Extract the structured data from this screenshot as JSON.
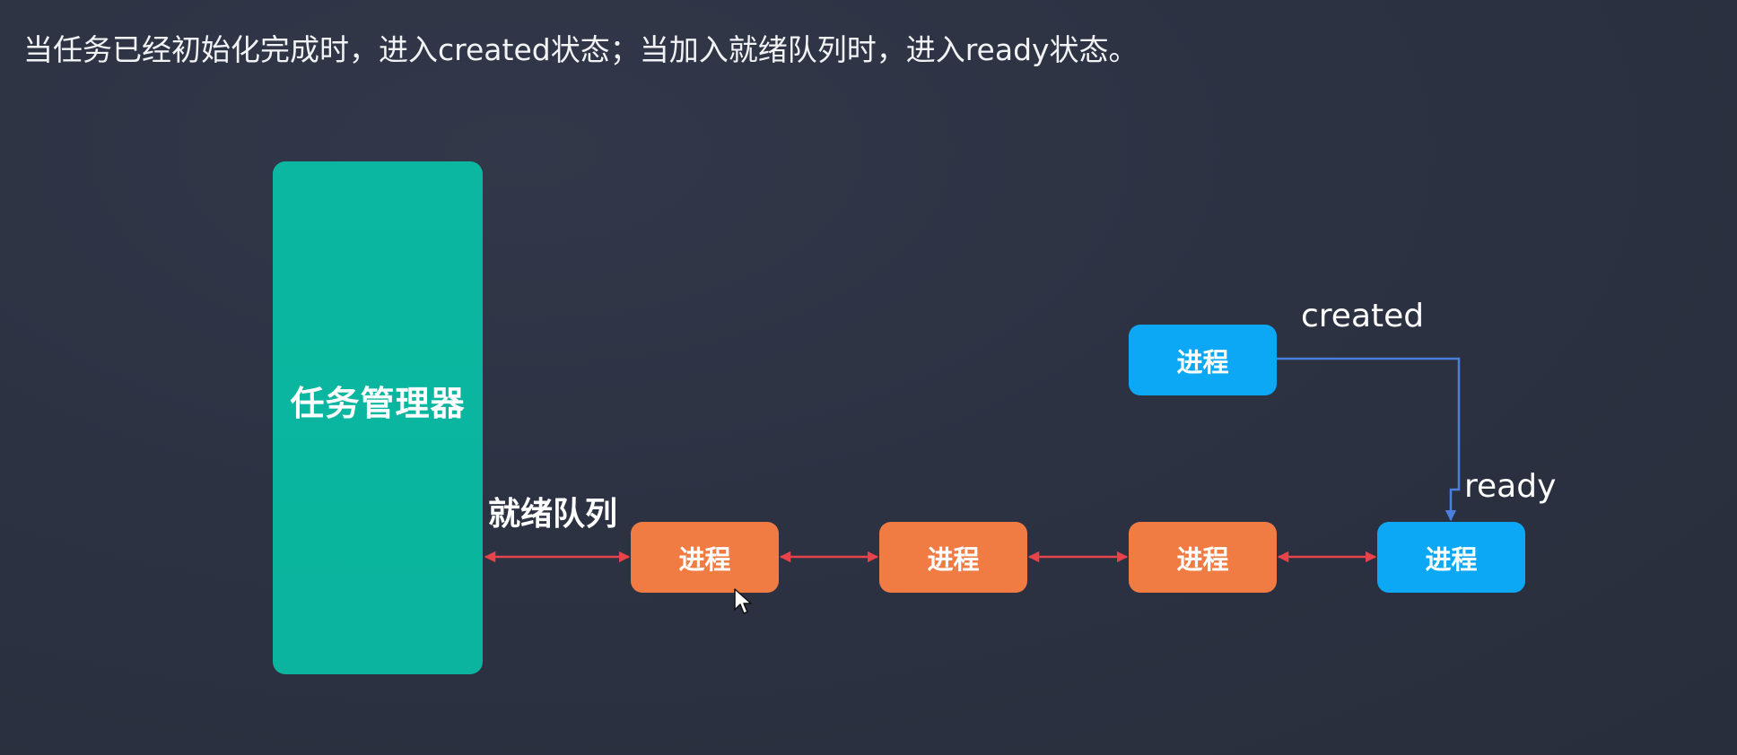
{
  "caption": "当任务已经初始化完成时，进入created状态；当加入就绪队列时，进入ready状态。",
  "diagram": {
    "manager_label": "任务管理器",
    "queue_label": "就绪队列",
    "nodes": [
      {
        "label": "进程",
        "state": "queued"
      },
      {
        "label": "进程",
        "state": "queued"
      },
      {
        "label": "进程",
        "state": "queued"
      },
      {
        "label": "进程",
        "state": "ready"
      },
      {
        "label": "进程",
        "state": "created"
      }
    ],
    "state_labels": {
      "created": "created",
      "ready": "ready"
    }
  },
  "colors": {
    "background": "#2b3140",
    "manager": "#0bb7a0",
    "queued_node": "#f07c44",
    "state_node": "#0ca8f6",
    "queue_arrow": "#e8434a",
    "transition_arrow": "#4a7fe0"
  },
  "icons": {
    "cursor": "mouse-pointer-icon"
  }
}
